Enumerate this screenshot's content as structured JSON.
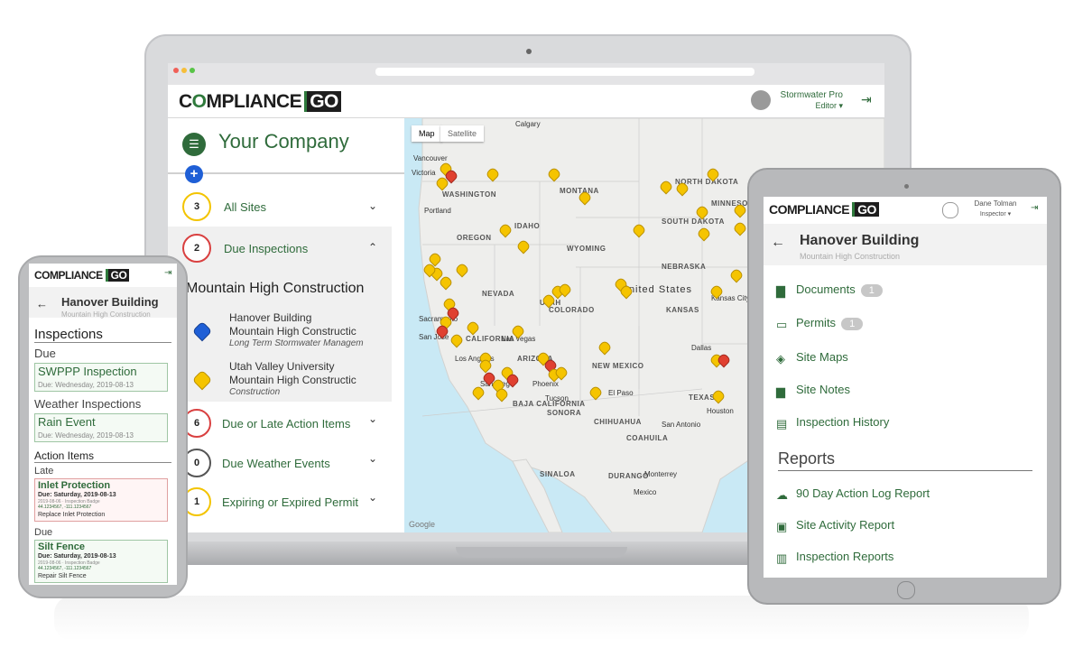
{
  "colors": {
    "brand_green": "#2f6b3b",
    "pin_yellow": "#f5c400",
    "pin_red": "#e04030",
    "badge_red": "#d94040",
    "map_water": "#c9e9f5"
  },
  "laptop": {
    "logo": {
      "left": "C",
      "o": "O",
      "rest": "MPLIANCE",
      "go": "GO"
    },
    "user": {
      "name": "Stormwater Pro",
      "role": "Editor ▾"
    },
    "company": "Your Company",
    "rows": [
      {
        "count": "3",
        "label": "All Sites"
      },
      {
        "count": "2",
        "label": "Due Inspections"
      },
      {
        "count": "6",
        "label": "Due or Late Action Items"
      },
      {
        "count": "0",
        "label": "Due Weather Events"
      },
      {
        "count": "1",
        "label": "Expiring or Expired Permit"
      }
    ],
    "group_title": "Mountain High Construction",
    "sites": [
      {
        "name": "Hanover Building",
        "company": "Mountain High Constructic",
        "note": "Long Term Stormwater Managem"
      },
      {
        "name": "Utah Valley University",
        "company": "Mountain High Constructic",
        "note": "Construction"
      }
    ],
    "map": {
      "tab_map": "Map",
      "tab_satellite": "Satellite",
      "footer": "Google",
      "states": [
        "WASHINGTON",
        "OREGON",
        "IDAHO",
        "MONTANA",
        "WYOMING",
        "NEVADA",
        "UTAH",
        "COLORADO",
        "CALIFORNIA",
        "ARIZONA",
        "NEW MEXICO",
        "TEXAS",
        "NEBRASKA",
        "KANSAS",
        "SOUTH DAKOTA",
        "MINNESOTA",
        "NORTH DAKOTA",
        "BAJA CALIFORNIA",
        "SONORA",
        "CHIHUAHUA",
        "COAHUILA",
        "SINALOA",
        "DURANGO"
      ],
      "country": "United States",
      "cities": [
        "Calgary",
        "Vancouver",
        "Victoria",
        "Portland",
        "Las Vegas",
        "Los Angeles",
        "San Diego",
        "Phoenix",
        "Tucson",
        "El Paso",
        "Dallas",
        "Houston",
        "San Antonio",
        "Monterrey",
        "Mexico",
        "Kansas City",
        "Sacramento",
        "San Jose"
      ]
    }
  },
  "phone": {
    "logo_text": "COMPLIANCE",
    "logo_go": "GO",
    "title": "Hanover Building",
    "subtitle": "Mountain High Construction",
    "section_inspections": "Inspections",
    "due": "Due",
    "swppp": "SWPPP Inspection",
    "swppp_date": "Due: Wednesday, 2019-08-13",
    "weather": "Weather Inspections",
    "rain": "Rain Event",
    "rain_date": "Due: Wednesday, 2019-08-13",
    "action_items": "Action Items",
    "late": "Late",
    "inlet": "Inlet Protection",
    "inlet_date": "Due: Saturday, 2019-08-13",
    "inlet_meta": "2019-08-06 · Inspection Badge",
    "inlet_coords": "44.1234567, -111.1234567",
    "inlet_action": "Replace Inlet Protection",
    "due2": "Due",
    "silt": "Silt Fence",
    "silt_date": "Due: Saturday, 2019-08-13",
    "silt_meta": "2019-08-06 · Inspection Badge",
    "silt_coords": "44.1234567, -111.1234567",
    "silt_action": "Repair Silt Fence"
  },
  "tablet": {
    "logo_text": "COMPLIANCE",
    "logo_go": "GO",
    "user": "Dane Tolman",
    "role": "Inspector ▾",
    "title": "Hanover Building",
    "subtitle": "Mountain High Construction",
    "items": [
      {
        "label": "Documents",
        "count": "1"
      },
      {
        "label": "Permits",
        "count": "1"
      },
      {
        "label": "Site Maps"
      },
      {
        "label": "Site Notes"
      },
      {
        "label": "Inspection History"
      }
    ],
    "reports_heading": "Reports",
    "reports": [
      "90 Day Action Log Report",
      "Site Activity Report",
      "Inspection Reports"
    ]
  }
}
